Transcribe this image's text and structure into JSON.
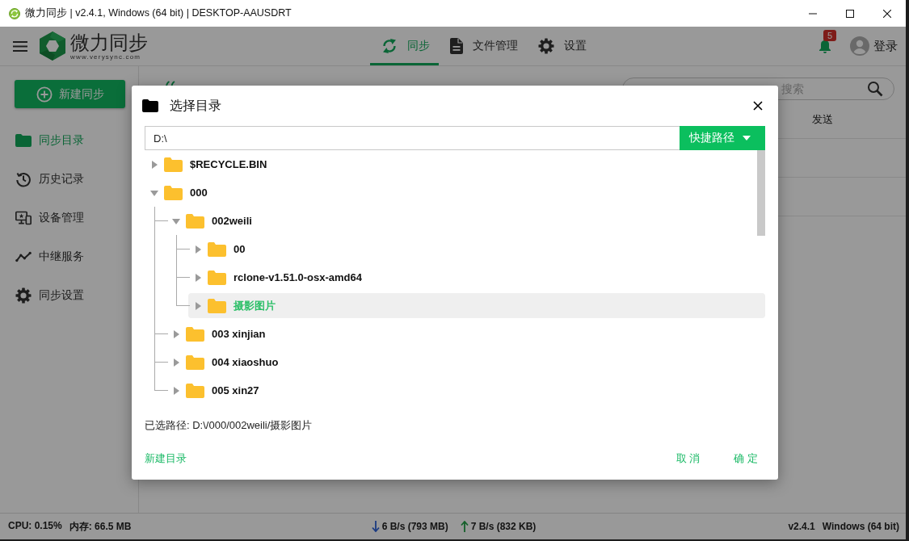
{
  "window": {
    "title": "微力同步 | v2.4.1, Windows (64 bit) | DESKTOP-AAUSDRT"
  },
  "header": {
    "logo": {
      "name": "微力同步",
      "url": "www.verysync.com"
    },
    "tabs": [
      {
        "label": "同步",
        "selected": true
      },
      {
        "label": "文件管理",
        "selected": false
      },
      {
        "label": "设置",
        "selected": false
      }
    ],
    "notification_count": "5",
    "login": "登录"
  },
  "sidebar": {
    "new_button": "新建同步",
    "items": [
      {
        "label": "同步目录",
        "selected": true
      },
      {
        "label": "历史记录",
        "selected": false
      },
      {
        "label": "设备管理",
        "selected": false
      },
      {
        "label": "中继服务",
        "selected": false
      },
      {
        "label": "同步设置",
        "selected": false
      }
    ]
  },
  "main": {
    "search": {
      "placeholder": "搜索"
    },
    "table": {
      "columns": [
        "发送"
      ]
    }
  },
  "dialog": {
    "title": "选择目录",
    "path": {
      "value": "D:\\"
    },
    "shortcut_button": "快捷路径",
    "tree": [
      {
        "name": "$RECYCLE.BIN",
        "expanded": false,
        "selected": false
      },
      {
        "name": "000",
        "expanded": true,
        "selected": false,
        "children": [
          {
            "name": "002weili",
            "expanded": true,
            "selected": false,
            "children": [
              {
                "name": "00",
                "expanded": false,
                "selected": false
              },
              {
                "name": "rclone-v1.51.0-osx-amd64",
                "expanded": false,
                "selected": false
              },
              {
                "name": "摄影图片",
                "expanded": false,
                "selected": true
              }
            ]
          },
          {
            "name": "003 xinjian",
            "expanded": false,
            "selected": false
          },
          {
            "name": "004 xiaoshuo",
            "expanded": false,
            "selected": false
          },
          {
            "name": "005 xin27",
            "expanded": false,
            "selected": false
          }
        ]
      }
    ],
    "selected_path": "已选路径: D:\\/000/002weili/摄影图片",
    "new_folder_link": "新建目录",
    "buttons": [
      "取 消",
      "确 定"
    ]
  },
  "status_bar": {
    "cpu": "CPU: 0.15%",
    "memory": "内存: 66.5 MB",
    "download": "6 B/s (793 MB)",
    "upload": "7 B/s (832 KB)",
    "version": "v2.4.1",
    "os": "Windows (64 bit)"
  }
}
